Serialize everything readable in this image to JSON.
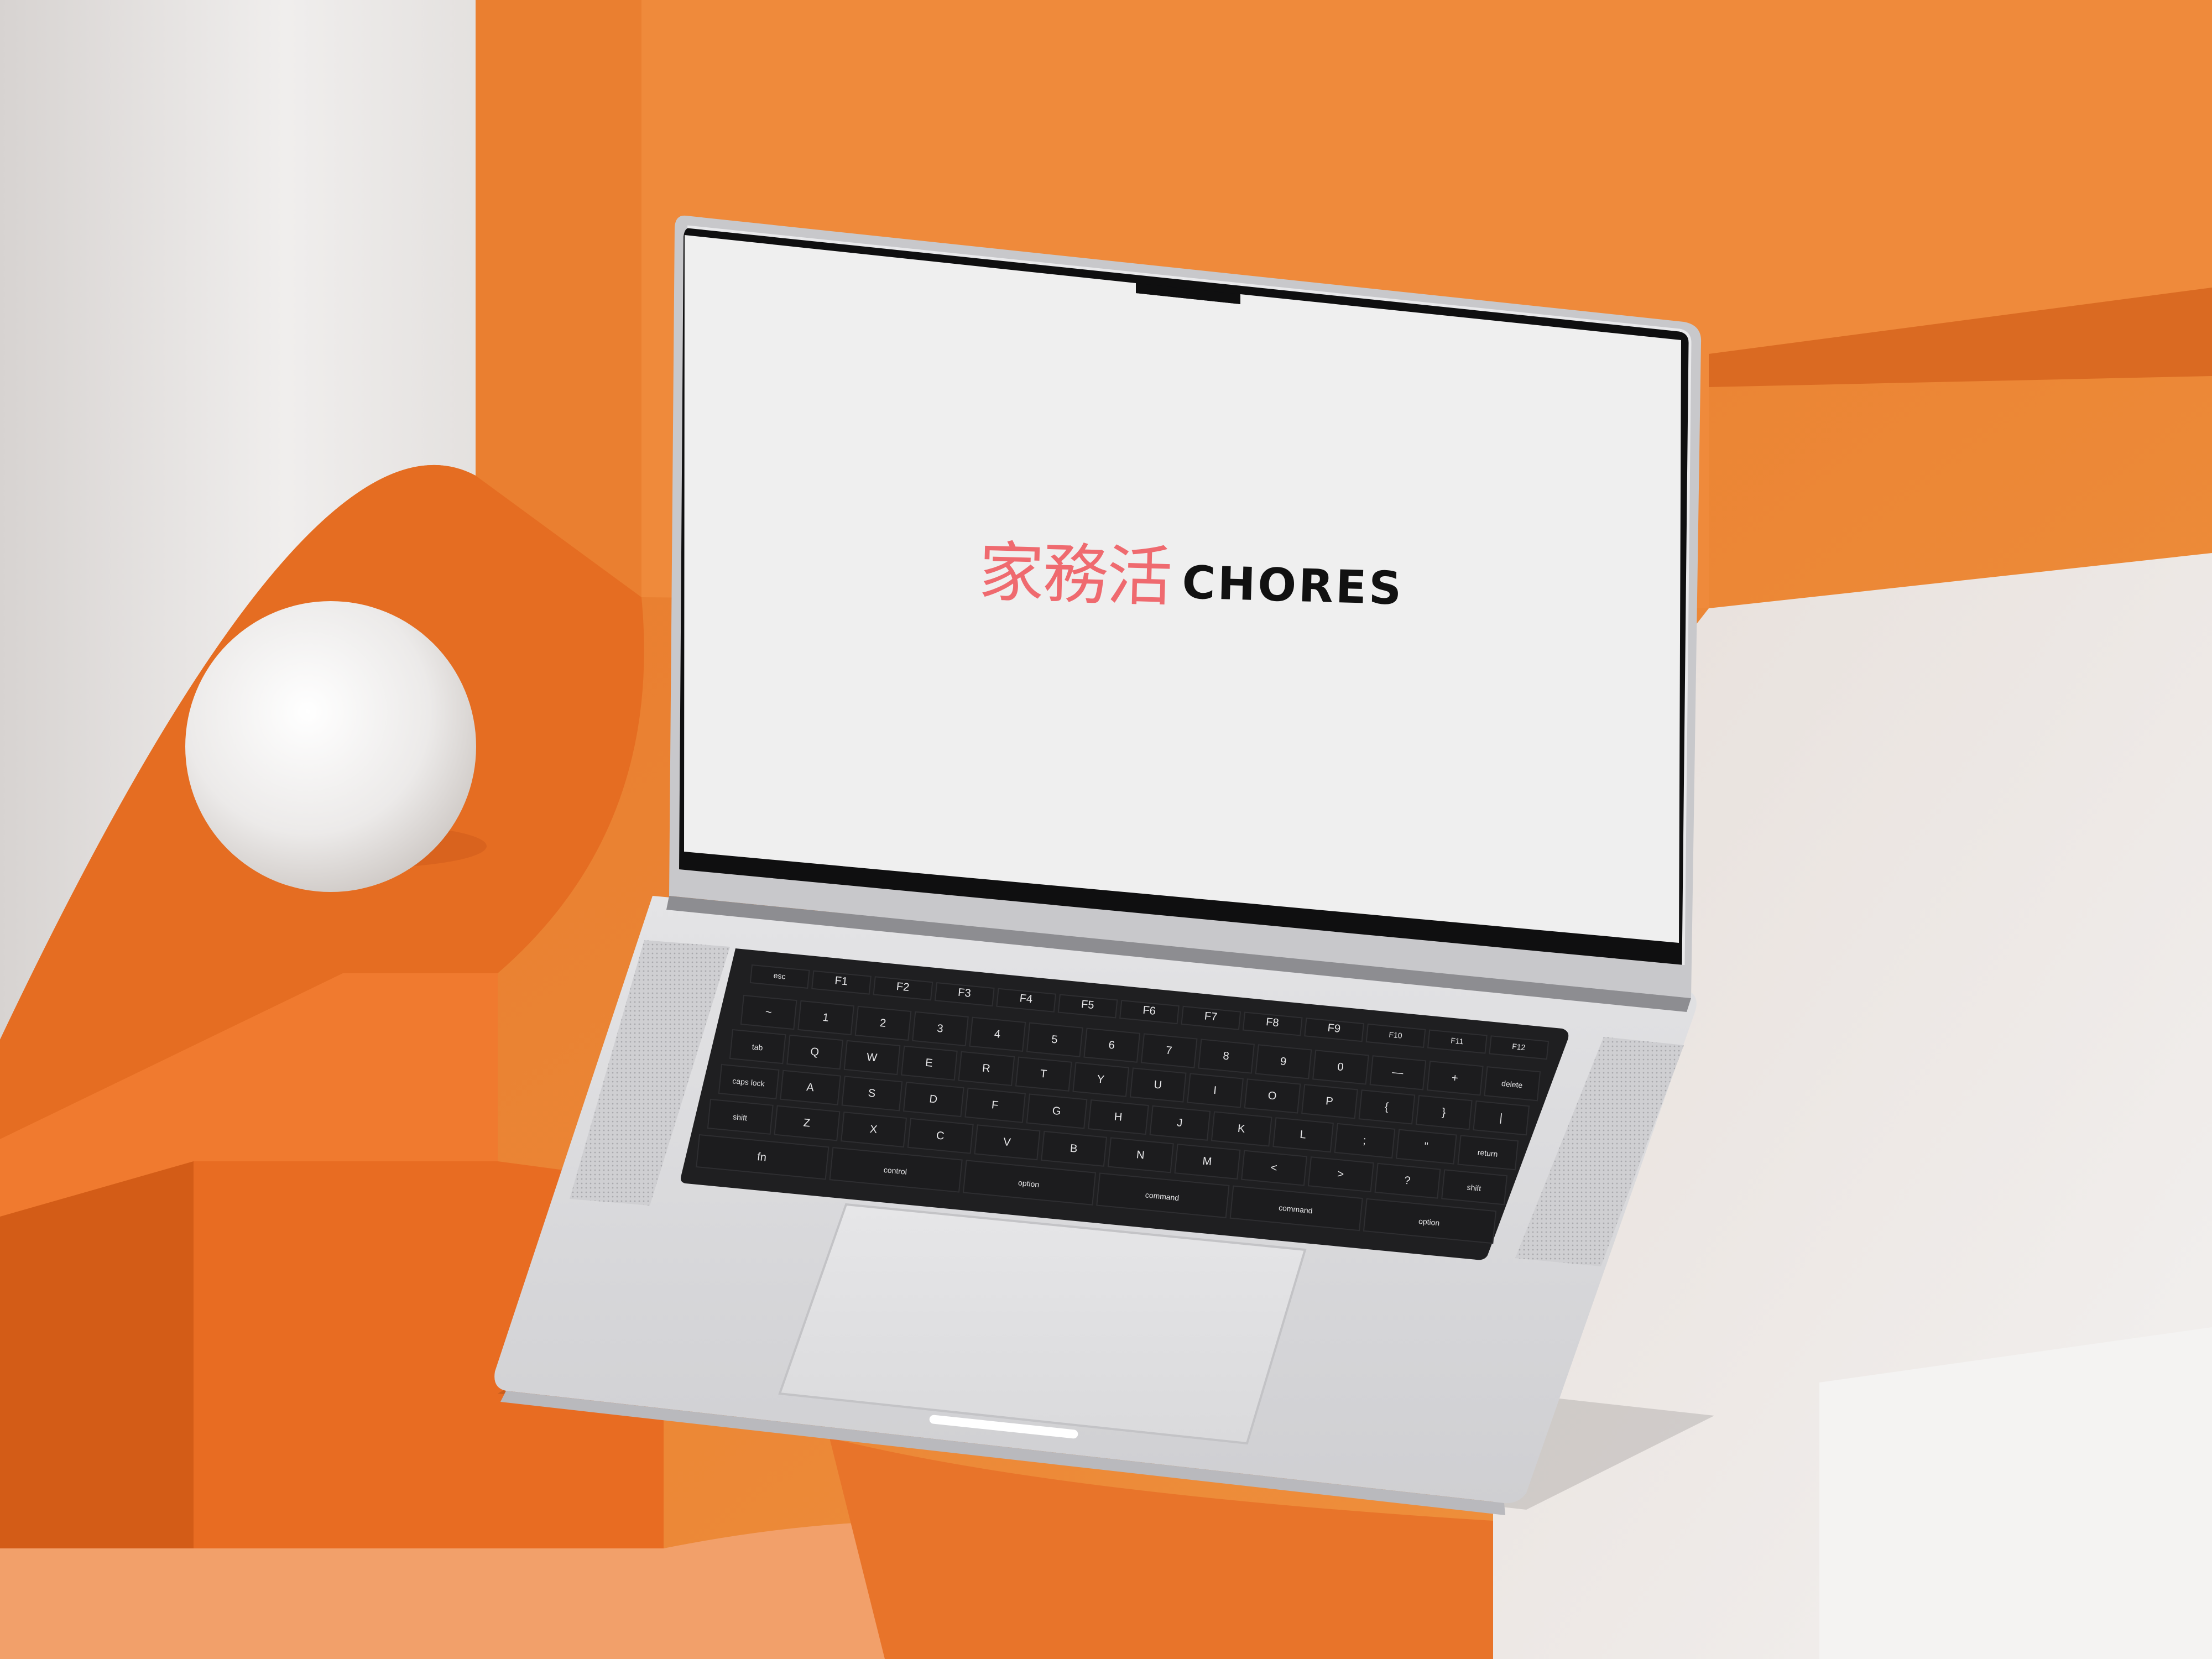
{
  "screen": {
    "background": "#efefef",
    "logo": {
      "chinese": "家務活",
      "english": "CHORES",
      "chinese_color": "#ef6a6f",
      "english_color": "#111111"
    }
  },
  "keyboard": {
    "function_row": [
      "esc",
      "F1",
      "F2",
      "F3",
      "F4",
      "F5",
      "F6",
      "F7",
      "F8",
      "F9",
      "F10",
      "F11",
      "F12"
    ],
    "number_row": [
      "~",
      "1",
      "2",
      "3",
      "4",
      "5",
      "6",
      "7",
      "8",
      "9",
      "0",
      "—",
      "+",
      "delete"
    ],
    "top_row": [
      "tab",
      "Q",
      "W",
      "E",
      "R",
      "T",
      "Y",
      "U",
      "I",
      "O",
      "P",
      "{",
      "}",
      "|"
    ],
    "home_row": [
      "caps lock",
      "A",
      "S",
      "D",
      "F",
      "G",
      "H",
      "J",
      "K",
      "L",
      ";",
      "\"",
      "return"
    ],
    "bottom_row": [
      "shift",
      "Z",
      "X",
      "C",
      "V",
      "B",
      "N",
      "M",
      "<",
      ">",
      "?",
      "shift"
    ],
    "modifier_row": [
      "fn",
      "control",
      "option",
      "command",
      "command",
      "option"
    ]
  },
  "colors": {
    "orange": "#e98535",
    "orange_dark": "#d9661f",
    "white_surface": "#ececec",
    "aluminium": "#d9d9db",
    "key": "#1c1c1e"
  }
}
